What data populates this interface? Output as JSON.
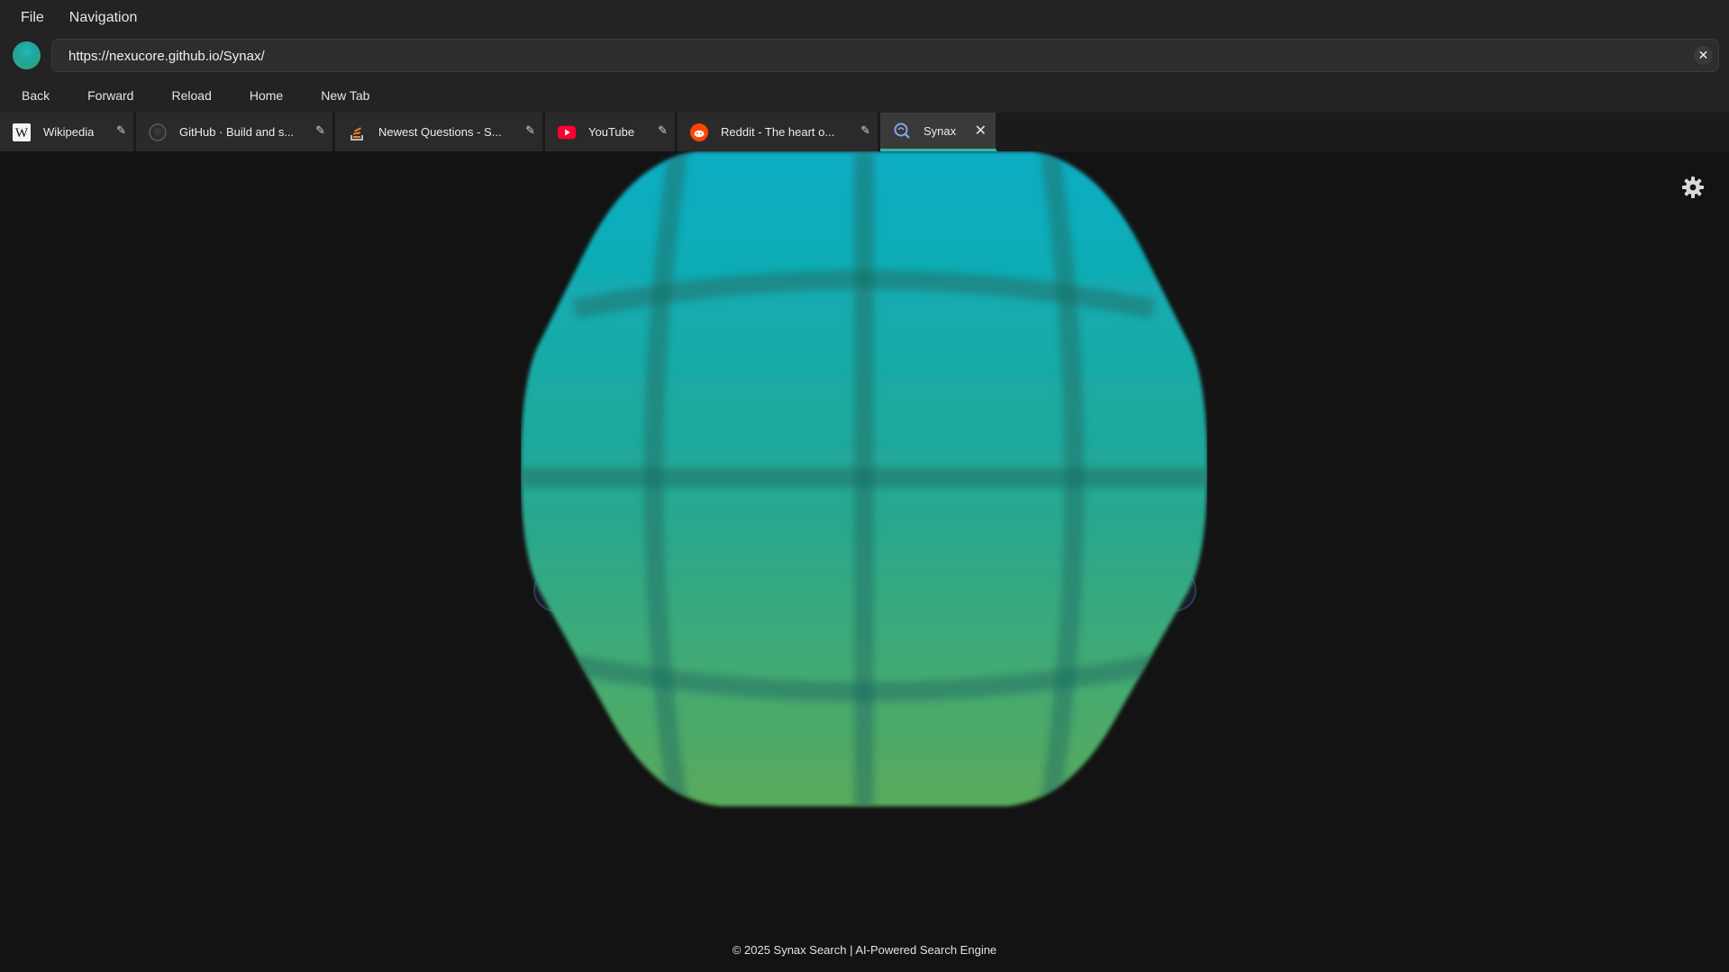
{
  "menu": {
    "file": "File",
    "navigation": "Navigation"
  },
  "address": {
    "url": "https://nexucore.github.io/Synax/",
    "clear_icon": "close-icon"
  },
  "nav": {
    "back": "Back",
    "forward": "Forward",
    "reload": "Reload",
    "home": "Home",
    "new_tab": "New Tab"
  },
  "tabs": [
    {
      "title": "Wikipedia",
      "icon": "wikipedia-icon",
      "pinned": true
    },
    {
      "title": "GitHub · Build and s...",
      "icon": "github-icon",
      "pinned": true
    },
    {
      "title": "Newest Questions - S...",
      "icon": "stackoverflow-icon",
      "pinned": true
    },
    {
      "title": "YouTube",
      "icon": "youtube-icon",
      "pinned": true
    },
    {
      "title": "Reddit - The heart o...",
      "icon": "reddit-icon",
      "pinned": true
    },
    {
      "title": "Synax",
      "icon": "synax-icon",
      "active": true
    }
  ],
  "page": {
    "settings_icon": "gear-icon",
    "logo": "synax-globe-logo",
    "footer": "© 2025 Synax Search | AI-Powered Search Engine"
  },
  "colors": {
    "background": "#131313",
    "chrome": "#232323",
    "accent": "#35b5a4",
    "logo_top": "#07aec5",
    "logo_bottom": "#5aab5a"
  }
}
